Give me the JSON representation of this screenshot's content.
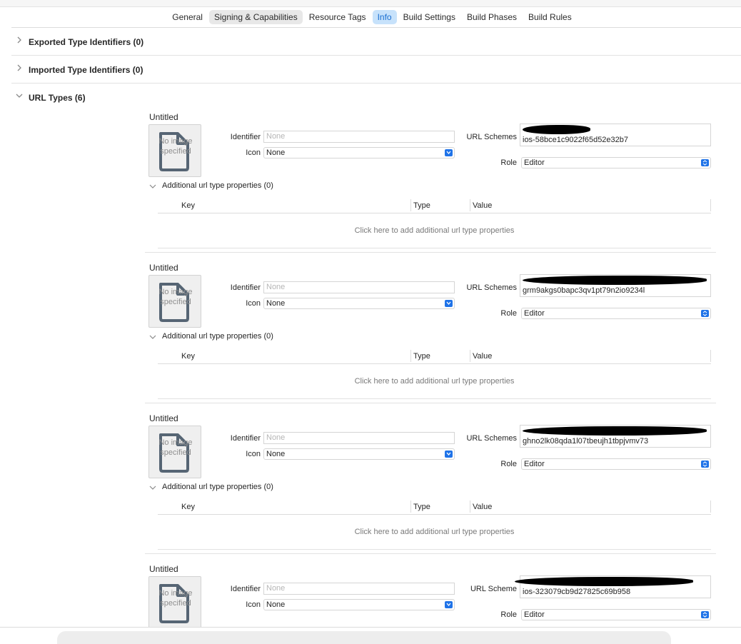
{
  "tabs": [
    {
      "label": "General"
    },
    {
      "label": "Signing & Capabilities"
    },
    {
      "label": "Resource Tags"
    },
    {
      "label": "Info"
    },
    {
      "label": "Build Settings"
    },
    {
      "label": "Build Phases"
    },
    {
      "label": "Build Rules"
    }
  ],
  "sections": {
    "exported": "Exported Type Identifiers (0)",
    "imported": "Imported Type Identifiers (0)",
    "url_types": "URL Types (6)"
  },
  "labels": {
    "identifier": "Identifier",
    "icon": "Icon",
    "url_schemes": "URL Schemes",
    "role": "Role",
    "no_image": "No image specified",
    "key": "Key",
    "type": "Type",
    "value": "Value",
    "empty_table": "Click here to add additional url type properties"
  },
  "entries": [
    {
      "title": "Untitled",
      "identifier_placeholder": "None",
      "icon": "None",
      "url_schemes_label": "URL Schemes",
      "scheme": "ios-58bce1c9022f65d52e32b7",
      "role": "Editor",
      "additional": "Additional url type properties (0)"
    },
    {
      "title": "Untitled",
      "identifier_placeholder": "None",
      "icon": "None",
      "url_schemes_label": "URL Schemes",
      "scheme": "grm9akgs0bapc3qv1pt79n2io9234l",
      "role": "Editor",
      "additional": "Additional url type properties (0)"
    },
    {
      "title": "Untitled",
      "identifier_placeholder": "None",
      "icon": "None",
      "url_schemes_label": "URL Schemes",
      "scheme": "ghno2lk08qda1l07tbeujh1tbpjvmv73",
      "role": "Editor",
      "additional": "Additional url type properties (0)"
    },
    {
      "title": "Untitled",
      "identifier_placeholder": "None",
      "icon": "None",
      "url_schemes_label": "URL Scheme",
      "scheme": "ios-323079cb9d27825c69b958",
      "role": "Editor",
      "additional": ""
    }
  ]
}
